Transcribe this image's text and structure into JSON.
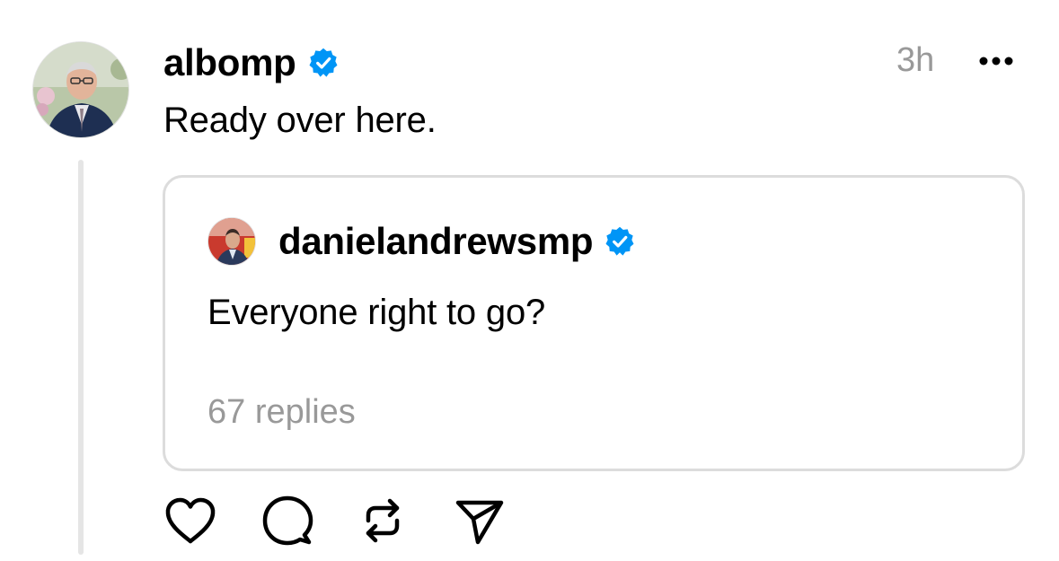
{
  "post": {
    "username": "albomp",
    "verified": true,
    "timestamp": "3h",
    "text": "Ready over here.",
    "avatar": "profile-photo-man-glasses-suit"
  },
  "quoted_post": {
    "username": "danielandrewsmp",
    "verified": true,
    "text": "Everyone right to go?",
    "replies": "67 replies",
    "avatar": "profile-photo-man-suit-red-background"
  },
  "actions": [
    {
      "name": "like",
      "icon": "heart-icon"
    },
    {
      "name": "reply",
      "icon": "speech-bubble-icon"
    },
    {
      "name": "repost",
      "icon": "repost-arrows-icon"
    },
    {
      "name": "share",
      "icon": "paper-plane-icon"
    }
  ],
  "colors": {
    "verified_blue": "#0095F6",
    "muted_text": "#999999",
    "border": "#DCDCDC",
    "thread_line": "#E5E5E5"
  }
}
